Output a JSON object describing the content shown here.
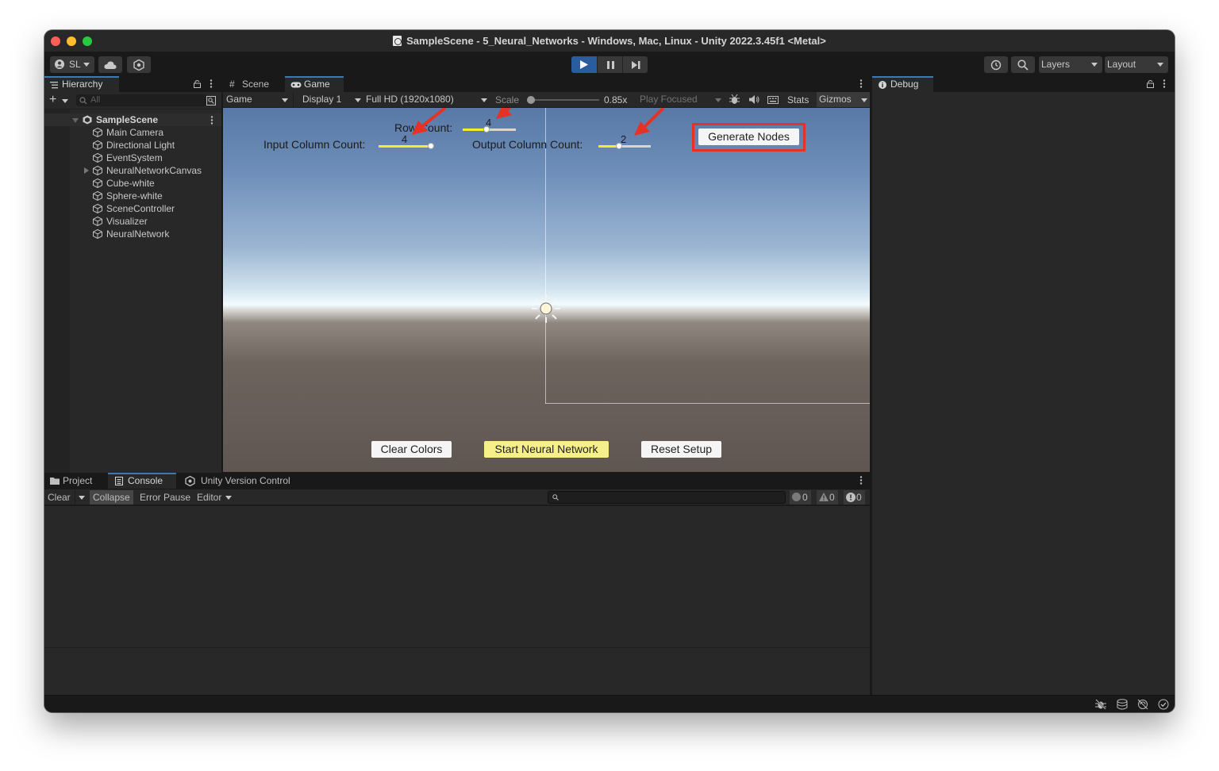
{
  "window": {
    "title": "SampleScene - 5_Neural_Networks - Windows, Mac, Linux - Unity 2022.3.45f1 <Metal>"
  },
  "toolbar": {
    "account_label": "SL",
    "layers_label": "Layers",
    "layout_label": "Layout"
  },
  "hierarchy": {
    "tab_label": "Hierarchy",
    "search_placeholder": "All",
    "scene_name": "SampleScene",
    "items": [
      {
        "label": "Main Camera"
      },
      {
        "label": "Directional Light"
      },
      {
        "label": "EventSystem"
      },
      {
        "label": "NeuralNetworkCanvas"
      },
      {
        "label": "Cube-white"
      },
      {
        "label": "Sphere-white"
      },
      {
        "label": "SceneController"
      },
      {
        "label": "Visualizer"
      },
      {
        "label": "NeuralNetwork"
      }
    ]
  },
  "game_panel": {
    "tabs": [
      {
        "label": "Scene"
      },
      {
        "label": "Game"
      }
    ],
    "view_dropdown": "Game",
    "display_dropdown": "Display 1",
    "resolution_dropdown": "Full HD (1920x1080)",
    "scale_label": "Scale",
    "scale_value": "0.85x",
    "play_focused": "Play Focused",
    "stats_label": "Stats",
    "gizmos_label": "Gizmos"
  },
  "game_ui": {
    "row_count_label": "Row Count:",
    "row_count_value": "4",
    "row_count_fraction": 0.45,
    "input_column_label": "Input Column Count:",
    "input_column_value": "4",
    "input_column_fraction": 1.0,
    "output_column_label": "Output Column Count:",
    "output_column_value": "2",
    "output_column_fraction": 0.4,
    "generate_nodes_label": "Generate Nodes",
    "clear_colors_label": "Clear Colors",
    "start_network_label": "Start Neural Network",
    "reset_setup_label": "Reset Setup"
  },
  "console_panel": {
    "tabs": [
      {
        "label": "Project"
      },
      {
        "label": "Console"
      },
      {
        "label": "Unity Version Control"
      }
    ],
    "clear_label": "Clear",
    "collapse_label": "Collapse",
    "error_pause_label": "Error Pause",
    "editor_label": "Editor",
    "info_count": "0",
    "warning_count": "0",
    "error_count": "0"
  },
  "debug_panel": {
    "tab_label": "Debug"
  },
  "colors": {
    "accent_blue": "#2a5d9e",
    "slider_yellow": "#f2ee2a",
    "highlight_red": "#e53224",
    "panel_bg": "#282828"
  }
}
